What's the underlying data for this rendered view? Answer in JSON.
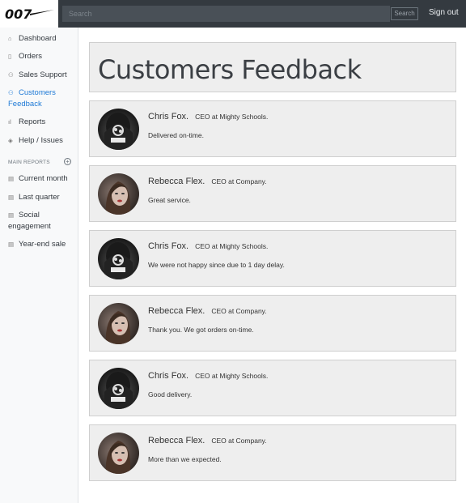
{
  "header": {
    "brand": "007",
    "search_placeholder": "Search",
    "search_button": "Search",
    "signout": "Sign out"
  },
  "sidebar": {
    "items": [
      {
        "label": "Dashboard",
        "icon": "home-icon"
      },
      {
        "label": "Orders",
        "icon": "file-icon"
      },
      {
        "label": "Sales Support",
        "icon": "users-icon"
      },
      {
        "label": "Customers Feedback",
        "icon": "users-icon",
        "active": true
      },
      {
        "label": "Reports",
        "icon": "bar-chart-icon"
      },
      {
        "label": "Help / Issues",
        "icon": "layers-icon"
      }
    ],
    "reports_heading": "MAIN REPORTS",
    "reports": [
      {
        "label": "Current month",
        "icon": "file-text-icon"
      },
      {
        "label": "Last quarter",
        "icon": "file-text-icon"
      },
      {
        "label": "Social engagement",
        "icon": "file-text-icon"
      },
      {
        "label": "Year-end sale",
        "icon": "file-text-icon"
      }
    ]
  },
  "main": {
    "title": "Customers Feedback",
    "feedback": [
      {
        "name": "Chris Fox.",
        "role": "CEO at Mighty Schools.",
        "message": "Delivered on-time.",
        "avatar": "man"
      },
      {
        "name": "Rebecca Flex.",
        "role": "CEO at Company.",
        "message": "Great service.",
        "avatar": "woman"
      },
      {
        "name": "Chris Fox.",
        "role": "CEO at Mighty Schools.",
        "message": "We were not happy since due to 1 day delay.",
        "avatar": "man"
      },
      {
        "name": "Rebecca Flex.",
        "role": "CEO at Company.",
        "message": "Thank you. We got orders on-time.",
        "avatar": "woman"
      },
      {
        "name": "Chris Fox.",
        "role": "CEO at Mighty Schools.",
        "message": "Good delivery.",
        "avatar": "man"
      },
      {
        "name": "Rebecca Flex.",
        "role": "CEO at Company.",
        "message": "More than we expected.",
        "avatar": "woman"
      }
    ]
  },
  "colors": {
    "navbar": "#343a40",
    "active_link": "#1f7ad6",
    "card_bg": "#eeeeee"
  }
}
